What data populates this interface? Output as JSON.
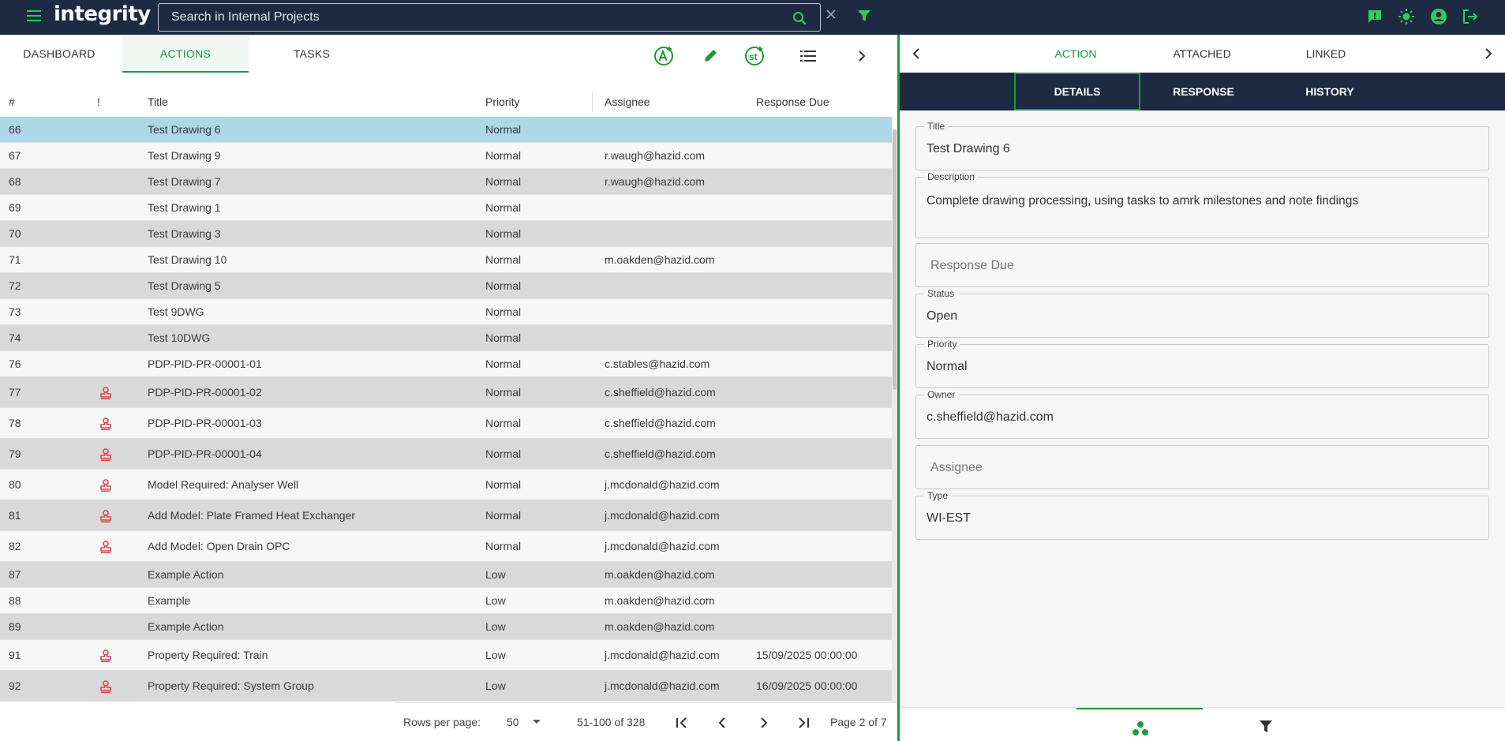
{
  "app": {
    "logo": "integrity"
  },
  "search": {
    "placeholder": "Search in Internal Projects"
  },
  "left_tabs": [
    "DASHBOARD",
    "ACTIONS",
    "TASKS"
  ],
  "table": {
    "headers": {
      "num": "#",
      "flag": "!",
      "title": "Title",
      "priority": "Priority",
      "assignee": "Assignee",
      "due": "Response Due"
    },
    "rows": [
      {
        "num": "66",
        "flag": false,
        "title": "Test Drawing 6",
        "priority": "Normal",
        "assignee": "",
        "due": ""
      },
      {
        "num": "67",
        "flag": false,
        "title": "Test Drawing 9",
        "priority": "Normal",
        "assignee": "r.waugh@hazid.com",
        "due": ""
      },
      {
        "num": "68",
        "flag": false,
        "title": "Test Drawing 7",
        "priority": "Normal",
        "assignee": "r.waugh@hazid.com",
        "due": ""
      },
      {
        "num": "69",
        "flag": false,
        "title": "Test Drawing 1",
        "priority": "Normal",
        "assignee": "",
        "due": ""
      },
      {
        "num": "70",
        "flag": false,
        "title": "Test Drawing 3",
        "priority": "Normal",
        "assignee": "",
        "due": ""
      },
      {
        "num": "71",
        "flag": false,
        "title": "Test Drawing 10",
        "priority": "Normal",
        "assignee": "m.oakden@hazid.com",
        "due": ""
      },
      {
        "num": "72",
        "flag": false,
        "title": "Test Drawing 5",
        "priority": "Normal",
        "assignee": "",
        "due": ""
      },
      {
        "num": "73",
        "flag": false,
        "title": "Test 9DWG",
        "priority": "Normal",
        "assignee": "",
        "due": ""
      },
      {
        "num": "74",
        "flag": false,
        "title": "Test 10DWG",
        "priority": "Normal",
        "assignee": "",
        "due": ""
      },
      {
        "num": "76",
        "flag": false,
        "title": "PDP-PID-PR-00001-01",
        "priority": "Normal",
        "assignee": "c.stables@hazid.com",
        "due": ""
      },
      {
        "num": "77",
        "flag": true,
        "title": "PDP-PID-PR-00001-02",
        "priority": "Normal",
        "assignee": "c.sheffield@hazid.com",
        "due": ""
      },
      {
        "num": "78",
        "flag": true,
        "title": "PDP-PID-PR-00001-03",
        "priority": "Normal",
        "assignee": "c.sheffield@hazid.com",
        "due": ""
      },
      {
        "num": "79",
        "flag": true,
        "title": "PDP-PID-PR-00001-04",
        "priority": "Normal",
        "assignee": "c.sheffield@hazid.com",
        "due": ""
      },
      {
        "num": "80",
        "flag": true,
        "title": "Model Required: Analyser Well",
        "priority": "Normal",
        "assignee": "j.mcdonald@hazid.com",
        "due": ""
      },
      {
        "num": "81",
        "flag": true,
        "title": "Add Model: Plate Framed Heat Exchanger",
        "priority": "Normal",
        "assignee": "j.mcdonald@hazid.com",
        "due": ""
      },
      {
        "num": "82",
        "flag": true,
        "title": "Add Model: Open Drain OPC",
        "priority": "Normal",
        "assignee": "j.mcdonald@hazid.com",
        "due": ""
      },
      {
        "num": "87",
        "flag": false,
        "title": "Example Action",
        "priority": "Low",
        "assignee": "m.oakden@hazid.com",
        "due": ""
      },
      {
        "num": "88",
        "flag": false,
        "title": "Example",
        "priority": "Low",
        "assignee": "m.oakden@hazid.com",
        "due": ""
      },
      {
        "num": "89",
        "flag": false,
        "title": "Example Action",
        "priority": "Low",
        "assignee": "m.oakden@hazid.com",
        "due": ""
      },
      {
        "num": "91",
        "flag": true,
        "title": "Property Required: Train",
        "priority": "Low",
        "assignee": "j.mcdonald@hazid.com",
        "due": "15/09/2025 00:00:00"
      },
      {
        "num": "92",
        "flag": true,
        "title": "Property Required: System Group",
        "priority": "Low",
        "assignee": "j.mcdonald@hazid.com",
        "due": "16/09/2025 00:00:00"
      }
    ]
  },
  "pager": {
    "rows_per_page_label": "Rows per page:",
    "rows_per_page": "50",
    "range": "51-100 of 328",
    "page": "Page 2 of 7"
  },
  "right_tabs": [
    "ACTION",
    "ATTACHED",
    "LINKED"
  ],
  "sub_tabs": [
    "DETAILS",
    "RESPONSE",
    "HISTORY"
  ],
  "form": {
    "title_label": "Title",
    "title_value": "Test Drawing 6",
    "description_label": "Description",
    "description_value": "Complete drawing processing, using tasks to amrk milestones and note findings",
    "response_due_placeholder": "Response Due",
    "status_label": "Status",
    "status_value": "Open",
    "priority_label": "Priority",
    "priority_value": "Normal",
    "owner_label": "Owner",
    "owner_value": "c.sheffield@hazid.com",
    "assignee_placeholder": "Assignee",
    "type_label": "Type",
    "type_value": "WI-EST"
  },
  "colors": {
    "nav_bg": "#1e2a42",
    "accent": "#1a9a3a",
    "selected_row": "#acd8e8",
    "flag": "#e0454b"
  }
}
